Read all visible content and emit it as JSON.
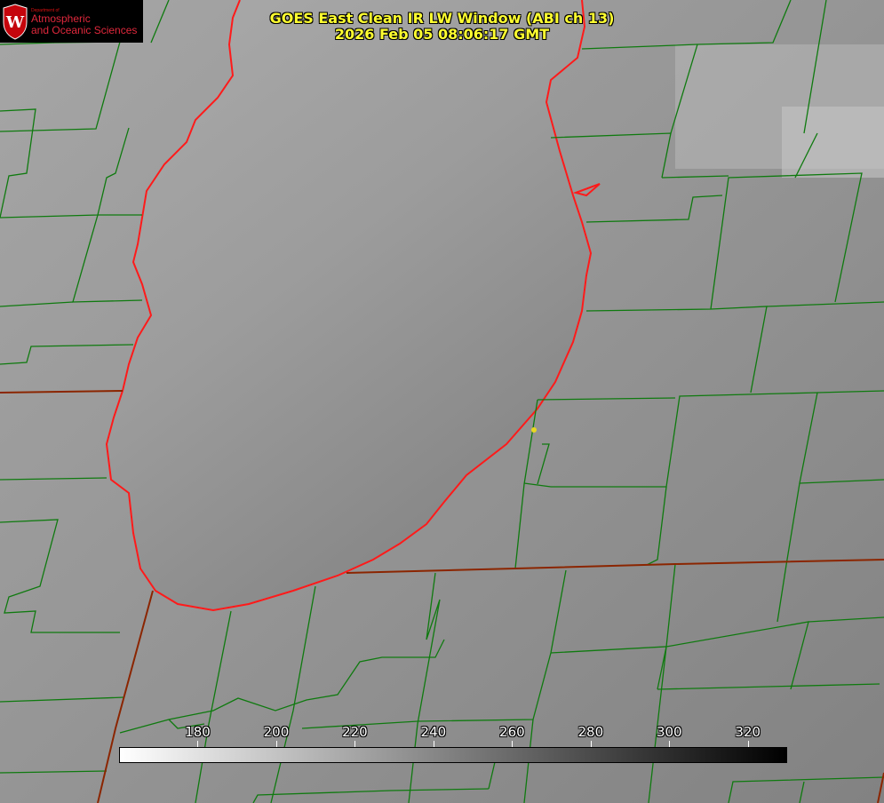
{
  "header": {
    "title_line1": "GOES East Clean IR LW Window (ABI ch 13)",
    "title_line2": "2026 Feb 05 08:06:17 GMT"
  },
  "logo": {
    "dept": "Department of",
    "line1": "Atmospheric",
    "line2": "and Oceanic Sciences"
  },
  "colorbar": {
    "min": 160,
    "max": 330,
    "ticks": [
      "180",
      "200",
      "220",
      "240",
      "260",
      "280",
      "300",
      "320"
    ],
    "color_low": "#ffffff",
    "color_high": "#000000"
  },
  "colors": {
    "county_lines": "#0f7a0f",
    "state_lines": "#8b2500",
    "lake_outline": "#ff1a1a",
    "marker": "#e8d820"
  }
}
